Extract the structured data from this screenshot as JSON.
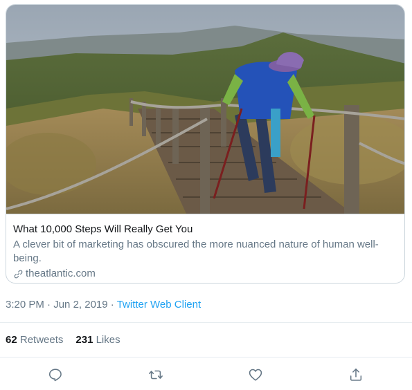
{
  "card": {
    "title": "What 10,000 Steps Will Really Get You",
    "description": "A clever bit of marketing has obscured the more nuanced nature of human well-being.",
    "domain": "theatlantic.com",
    "domain_icon": "link-icon"
  },
  "meta": {
    "time": "3:20 PM",
    "separator": "·",
    "date": "Jun 2, 2019",
    "client": "Twitter Web Client"
  },
  "stats": {
    "retweets_count": "62",
    "retweets_label": "Retweets",
    "likes_count": "231",
    "likes_label": "Likes"
  },
  "actions": [
    {
      "name": "reply",
      "icon": "comment-icon"
    },
    {
      "name": "retweet",
      "icon": "retweet-icon"
    },
    {
      "name": "like",
      "icon": "heart-icon"
    },
    {
      "name": "share",
      "icon": "share-icon"
    }
  ],
  "colors": {
    "link": "#1da1f2",
    "secondary_text": "#657786",
    "border": "#ccd6dd"
  }
}
